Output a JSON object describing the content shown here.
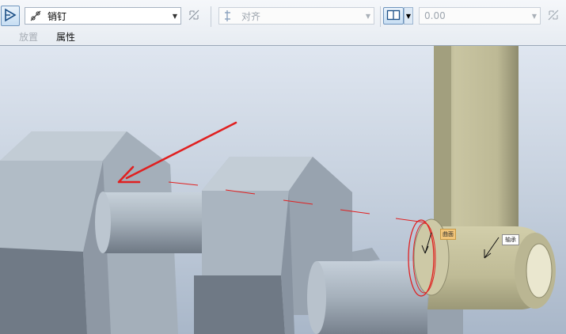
{
  "toolbar": {
    "constraint_type": {
      "value": "销钉"
    },
    "alignment": {
      "value": "对齐"
    },
    "offset": {
      "value": "0.00"
    }
  },
  "tabs": {
    "placement": "放置",
    "properties": "属性"
  },
  "viewport": {
    "callout_left": "曲面",
    "callout_right": "轴承",
    "colors": {
      "part_gray": "#a9b4bd",
      "conn_rod": "#c9c5a2",
      "arrow_red": "#e02020"
    }
  }
}
